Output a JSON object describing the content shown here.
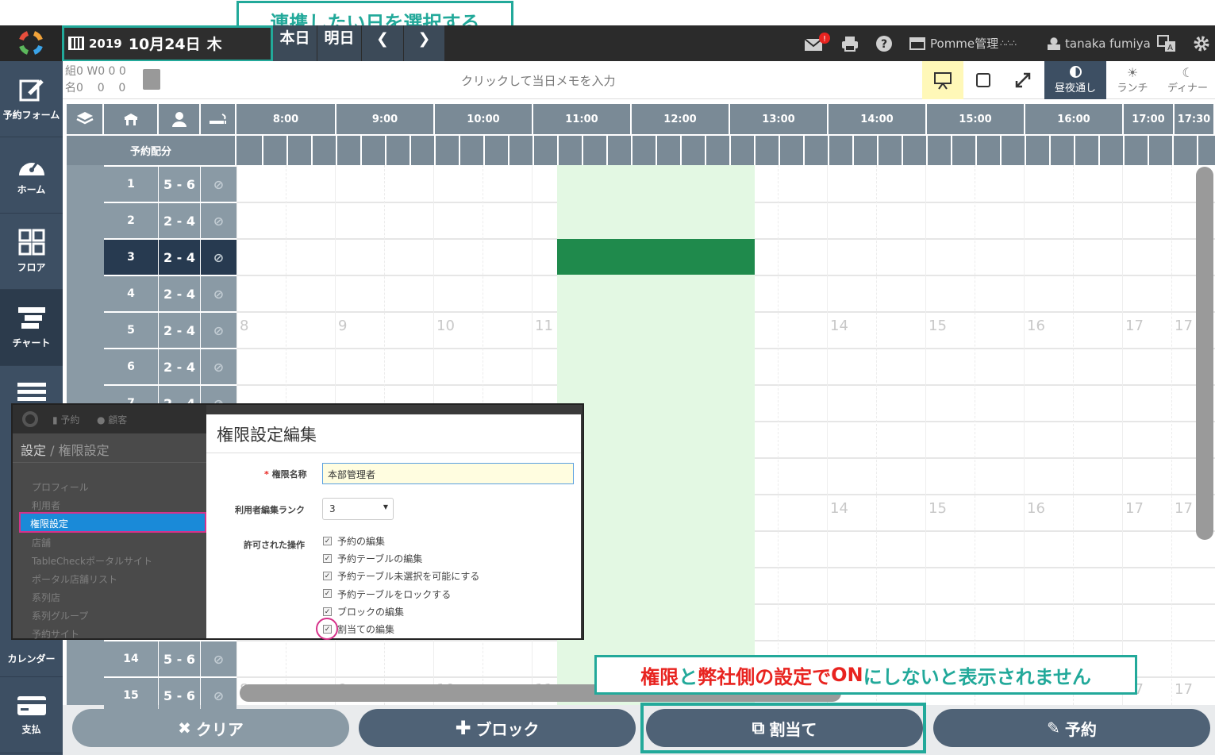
{
  "callouts": {
    "date_select": "連携したい日を選択する",
    "note_part1": "権限",
    "note_part2": "と",
    "note_part3": "弊社側の設定で",
    "note_part4": "ON",
    "note_part5": "にしないと表示されません"
  },
  "topbar": {
    "year": "2019",
    "date": "10月24日",
    "weekday": "木",
    "today": "本日",
    "tomorrow": "明日",
    "shop": "Pomme管理",
    "user": "tanaka fumiya"
  },
  "nav": [
    {
      "label": "予約フォーム"
    },
    {
      "label": "ホーム"
    },
    {
      "label": "フロア"
    },
    {
      "label": "チャート"
    },
    {
      "label": "カレンダー"
    },
    {
      "label": "支払"
    }
  ],
  "memo": {
    "counts_row1": "組0 W0 0 0",
    "counts_row2": "名0    0    0",
    "placeholder": "クリックして当日メモを入力",
    "day_all": "昼夜通し",
    "lunch": "ランチ",
    "dinner": "ディナー"
  },
  "header": {
    "allocation": "予約配分",
    "times": [
      "8:00",
      "9:00",
      "10:00",
      "11:00",
      "12:00",
      "13:00",
      "14:00",
      "15:00",
      "16:00",
      "17:00",
      "17:30"
    ]
  },
  "rows": [
    {
      "no": "1",
      "cap": "5 - 6"
    },
    {
      "no": "2",
      "cap": "2 - 4"
    },
    {
      "no": "3",
      "cap": "2 - 4"
    },
    {
      "no": "4",
      "cap": "2 - 4"
    },
    {
      "no": "5",
      "cap": "2 - 4"
    },
    {
      "no": "6",
      "cap": "2 - 4"
    },
    {
      "no": "7",
      "cap": "2 - 4"
    },
    {
      "no": "14",
      "cap": "5 - 6"
    },
    {
      "no": "15",
      "cap": "5 - 6"
    }
  ],
  "bg_hours": [
    "8",
    "9",
    "10",
    "11",
    "14",
    "15",
    "16",
    "17",
    "17"
  ],
  "bottom": {
    "clear": "クリア",
    "block": "ブロック",
    "assign": "割当て",
    "reserve": "予約"
  },
  "overlay": {
    "top_links": [
      "予約",
      "顧客"
    ],
    "breadcrumb_a": "設定",
    "breadcrumb_b": "権限設定",
    "side": [
      "プロフィール",
      "利用者",
      "権限設定",
      "店舗",
      "TableCheckポータルサイト",
      "ポータル店舗リスト",
      "系列店",
      "系列グループ",
      "予約サイト"
    ],
    "title": "権限設定編集",
    "name_label": "権限名称",
    "name_value": "本部管理者",
    "rank_label": "利用者編集ランク",
    "rank_value": "3",
    "ops_label": "許可された操作",
    "ops": [
      "予約の編集",
      "予約テーブルの編集",
      "予約テーブル未選択を可能にする",
      "予約テーブルをロックする",
      "ブロックの編集",
      "割当ての編集"
    ]
  },
  "colors": {
    "teal": "#22a99a",
    "navy": "#3d4f63",
    "green": "#1f8a4c",
    "red": "#e8231f"
  }
}
